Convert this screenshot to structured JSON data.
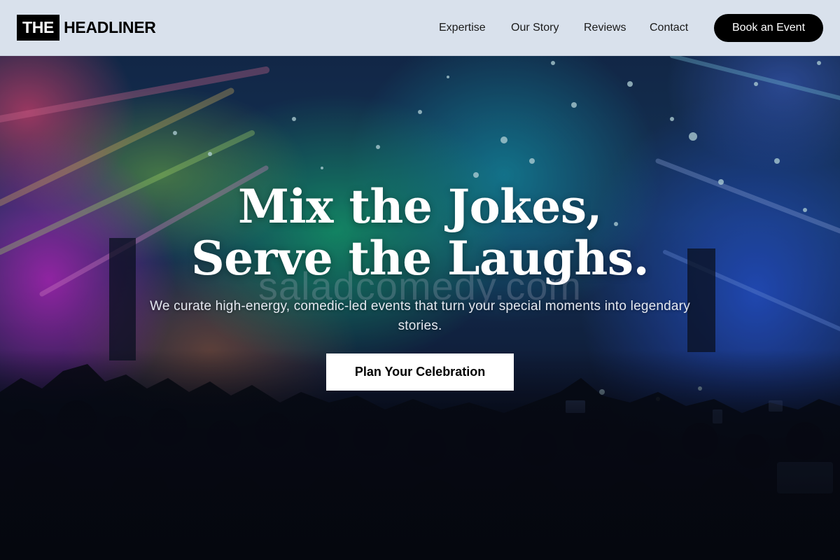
{
  "brand": {
    "box_text": "THE",
    "name_text": "HEADLINER"
  },
  "nav": {
    "links": [
      "Expertise",
      "Our Story",
      "Reviews",
      "Contact"
    ],
    "cta_label": "Book an Event"
  },
  "hero": {
    "headline_line1": "Mix the Jokes,",
    "headline_line2": "Serve the Laughs.",
    "watermark": "saladcomedy.com",
    "subtext": "We curate high-energy, comedic-led events that turn your special moments into legendary stories.",
    "cta_label": "Plan Your Celebration"
  },
  "colors": {
    "nav_bg": "#d9e1ec",
    "primary_button": "#000000",
    "cta_button": "#ffffff"
  }
}
